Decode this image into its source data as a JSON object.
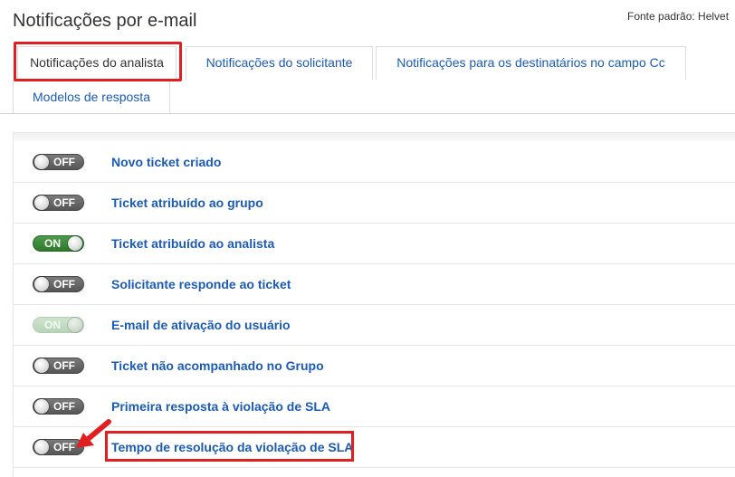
{
  "page": {
    "title": "Notificações por e-mail",
    "font_label": "Fonte padrão: Helvet"
  },
  "tabs": [
    {
      "label": "Notificações do analista",
      "active": true
    },
    {
      "label": "Notificações do solicitante",
      "active": false
    },
    {
      "label": "Notificações para os destinatários no campo Cc",
      "active": false
    },
    {
      "label": "Modelos de resposta",
      "active": false
    }
  ],
  "notifications": [
    {
      "label": "Novo ticket criado",
      "state": "OFF",
      "enabled": true
    },
    {
      "label": "Ticket atribuído ao grupo",
      "state": "OFF",
      "enabled": true
    },
    {
      "label": "Ticket atribuído ao analista",
      "state": "ON",
      "enabled": true
    },
    {
      "label": "Solicitante responde ao ticket",
      "state": "OFF",
      "enabled": true
    },
    {
      "label": "E-mail de ativação do usuário",
      "state": "ON",
      "enabled": false
    },
    {
      "label": "Ticket não acompanhado no Grupo",
      "state": "OFF",
      "enabled": true
    },
    {
      "label": "Primeira resposta à violação de SLA",
      "state": "OFF",
      "enabled": true
    },
    {
      "label": "Tempo de resolução da violação de SLA",
      "state": "OFF",
      "enabled": true
    }
  ],
  "colors": {
    "link": "#1a5bb5",
    "highlight": "#e02020",
    "toggle_on": "#2d7a2d",
    "toggle_off": "#5e5e5e"
  },
  "icons": {
    "annotation_arrow": "red-arrow-icon",
    "toggle_knob": "toggle-knob-icon"
  }
}
